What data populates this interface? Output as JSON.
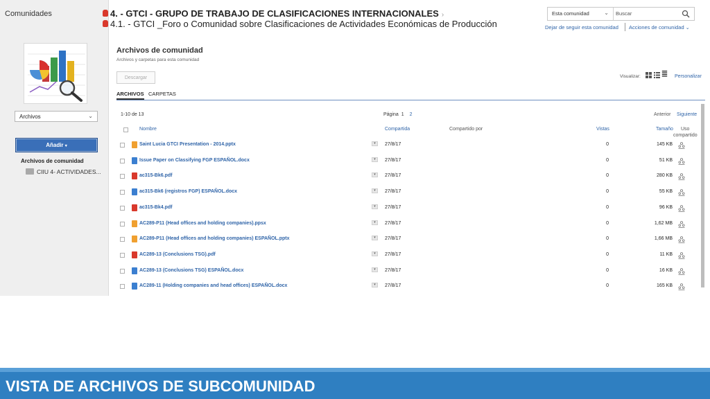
{
  "sidebar": {
    "title": "Comunidades",
    "view_select": "Archivos",
    "add_button": "Añadir",
    "section_title": "Archivos de comunidad",
    "folder_item": "CIIU 4- ACTIVIDADES..."
  },
  "header": {
    "breadcrumb_1": "4. - GTCI - GRUPO DE TRABAJO DE CLASIFICACIONES INTERNACIONALES",
    "breadcrumb_2": "4.1. - GTCI _Foro o Comunidad sobre Clasificaciones de Actividades Económicas de Producción",
    "search_scope": "Esta comunidad",
    "search_placeholder": "Buscar",
    "follow_link": "Dejar de seguir esta comunidad",
    "actions_link": "Acciones de comunidad"
  },
  "main": {
    "title": "Archivos de comunidad",
    "subtitle": "Archivos y carpetas para esta comunidad",
    "download_button": "Descargar",
    "visualize_label": "Visualizar:",
    "personalize_link": "Personalizar",
    "tabs": [
      {
        "label": "ARCHIVOS",
        "active": true
      },
      {
        "label": "CARPETAS",
        "active": false
      }
    ],
    "range_label": "1-10 de 13",
    "page_label": "Página",
    "page_current": "1",
    "page_next": "2",
    "prev_label": "Anterior",
    "next_label": "Siguiente",
    "columns": {
      "name": "Nombre",
      "shared": "Compartida",
      "shared_by": "Compartido por",
      "views": "Vistas",
      "size": "Tamaño",
      "usage_1": "Uso",
      "usage_2": "compartido"
    },
    "files": [
      {
        "name": "Saint Lucia GTCI Presentation - 2014.pptx",
        "type": "pptx",
        "date": "27/8/17",
        "views": "0",
        "size": "145 KB"
      },
      {
        "name": "Issue Paper on Classifying FGP ESPAÑOL.docx",
        "type": "docx",
        "date": "27/8/17",
        "views": "0",
        "size": "51 KB"
      },
      {
        "name": "ac315-Bk6.pdf",
        "type": "pdf",
        "date": "27/8/17",
        "views": "0",
        "size": "280 KB"
      },
      {
        "name": "ac315-Bk6 (registros FGP) ESPAÑOL.docx",
        "type": "docx",
        "date": "27/8/17",
        "views": "0",
        "size": "55 KB"
      },
      {
        "name": "ac315-Bk4.pdf",
        "type": "pdf",
        "date": "27/8/17",
        "views": "0",
        "size": "96 KB"
      },
      {
        "name": "AC289-P11 (Head offices and holding companies).ppsx",
        "type": "pptx",
        "date": "27/8/17",
        "views": "0",
        "size": "1,62 MB"
      },
      {
        "name": "AC289-P11 (Head offices and holding companies) ESPAÑOL.pptx",
        "type": "pptx",
        "date": "27/8/17",
        "views": "0",
        "size": "1,66 MB"
      },
      {
        "name": "AC289-13 (Conclusions TSG).pdf",
        "type": "pdf",
        "date": "27/8/17",
        "views": "0",
        "size": "11 KB"
      },
      {
        "name": "AC289-13 (Conclusions TSG) ESPAÑOL.docx",
        "type": "docx",
        "date": "27/8/17",
        "views": "0",
        "size": "16 KB"
      },
      {
        "name": "AC289-11 (Holding companies and head offices) ESPAÑOL.docx",
        "type": "docx",
        "date": "27/8/17",
        "views": "0",
        "size": "165 KB"
      }
    ]
  },
  "banner": {
    "text": "VISTA DE ARCHIVOS DE SUBCOMUNIDAD"
  },
  "colors": {
    "link": "#2f64a8",
    "banner": "#2f7fc1",
    "pdf": "#d9392c",
    "docx": "#3b7fd0",
    "pptx": "#f0a030"
  }
}
